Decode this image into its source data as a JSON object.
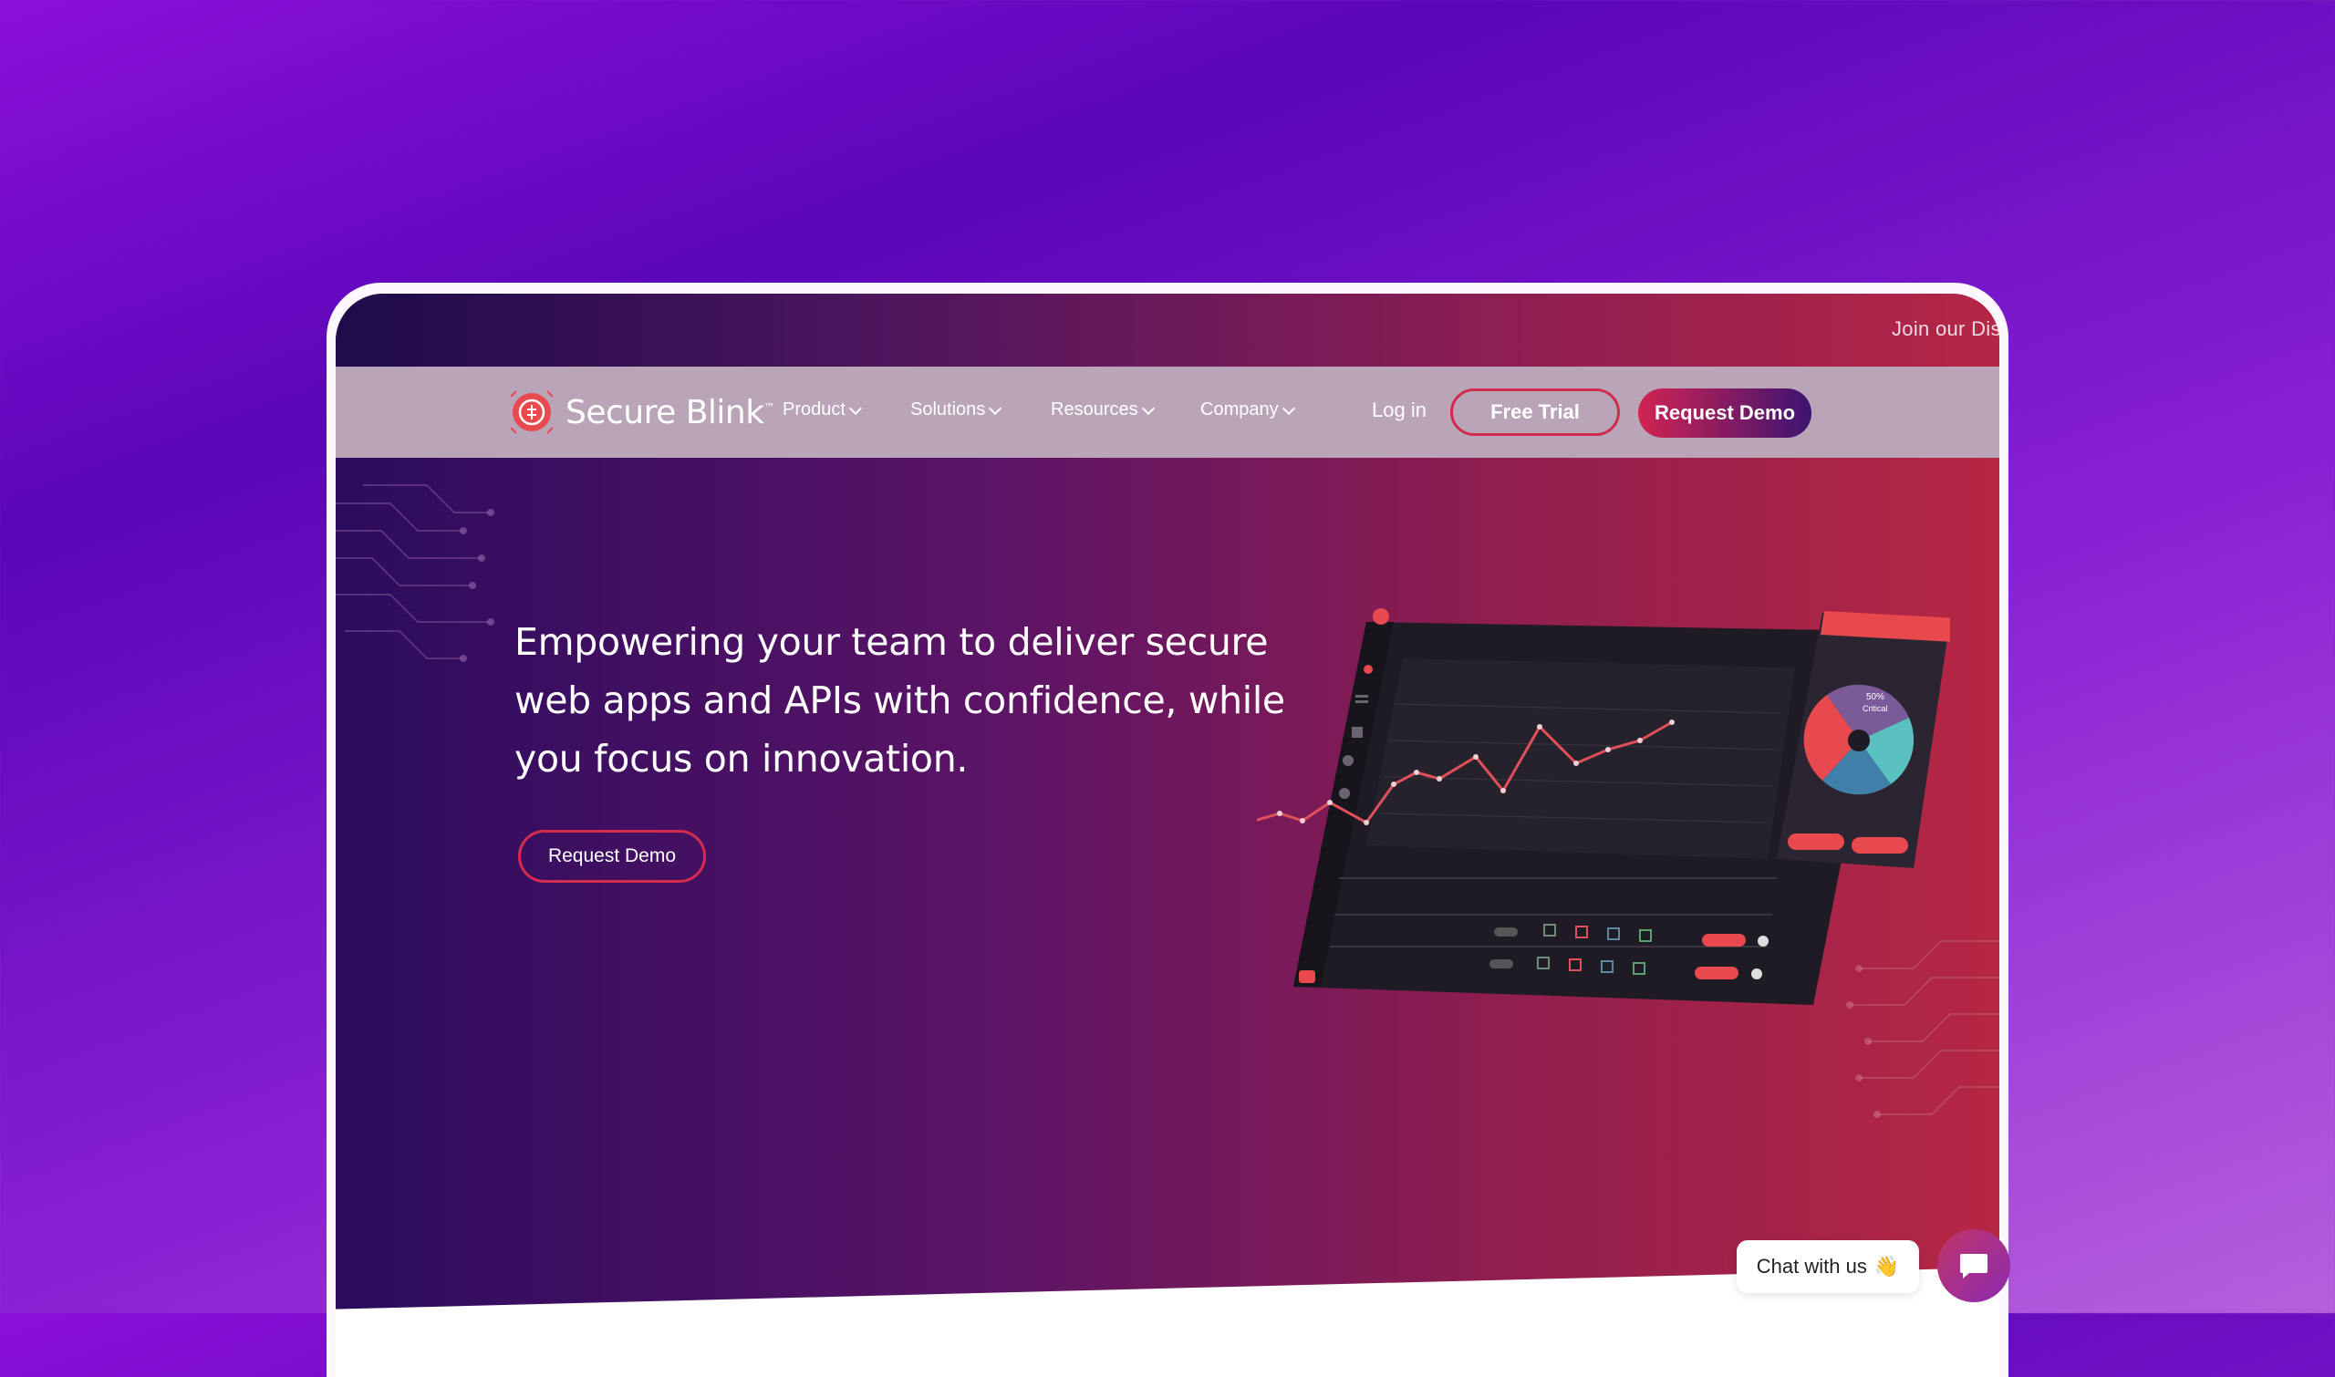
{
  "announcement": {
    "text": "Join our Dis"
  },
  "brand": {
    "name": "Secure Blink",
    "trademark": "™"
  },
  "nav": {
    "items": [
      {
        "label": "Product"
      },
      {
        "label": "Solutions"
      },
      {
        "label": "Resources"
      },
      {
        "label": "Company"
      }
    ],
    "login_label": "Log in",
    "free_trial_label": "Free Trial",
    "request_demo_label": "Request Demo"
  },
  "hero": {
    "title": "Empowering your team to deliver secure web apps and APIs with confidence, while you focus on innovation.",
    "cta_label": "Request Demo"
  },
  "dashboard": {
    "donut_center_percent": "50%",
    "donut_center_label": "Critical"
  },
  "chat": {
    "label": "Chat with us",
    "emoji": "👋"
  },
  "colors": {
    "accent": "#d12b4c",
    "navbar": "#b9a4b8"
  }
}
